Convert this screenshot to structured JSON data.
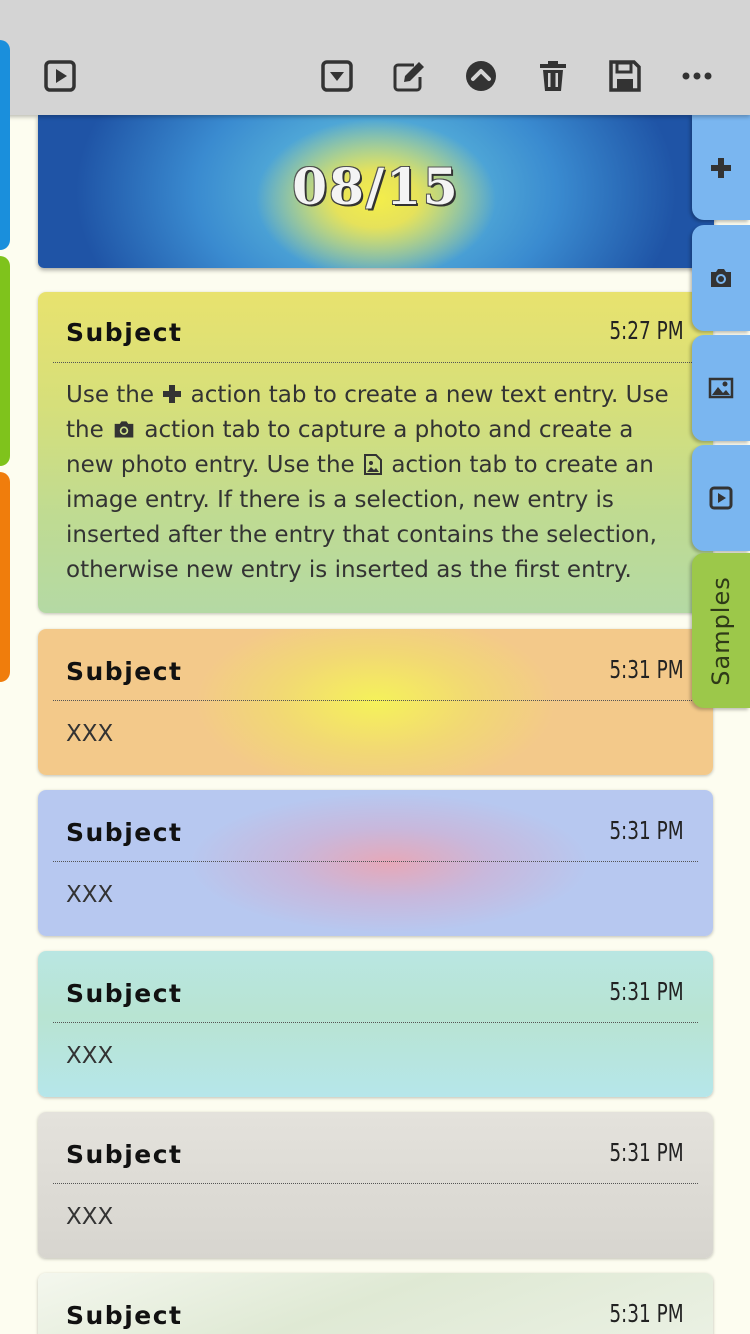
{
  "toolbar": {
    "buttons": [
      {
        "name": "play-icon"
      },
      {
        "name": "dropdown-icon"
      },
      {
        "name": "edit-icon"
      },
      {
        "name": "collapse-up-icon"
      },
      {
        "name": "trash-icon"
      },
      {
        "name": "save-icon"
      },
      {
        "name": "more-icon"
      }
    ]
  },
  "left_tabs": [
    {
      "color": "#1a8fdc"
    },
    {
      "color": "#7fc31c"
    },
    {
      "color": "#f07d0c"
    }
  ],
  "banner": {
    "date": "08/15"
  },
  "right_tabs": {
    "add": "plus-icon",
    "camera": "camera-icon",
    "image": "image-icon",
    "play": "play-icon",
    "samples": "Samples"
  },
  "entries": [
    {
      "subject": "Subject",
      "time": "5:27 PM",
      "body": {
        "t1": "Use the",
        "t2": "action tab to create a new text entry. Use the",
        "t3": "action tab to capture a photo and create a new photo entry. Use the",
        "t4": "action tab to create an image entry. If there is a selection, new entry is inserted after the entry that contains the selection, otherwise new entry is inserted as the first entry."
      }
    },
    {
      "subject": "Subject",
      "time": "5:31 PM",
      "body": "XXX"
    },
    {
      "subject": "Subject",
      "time": "5:31 PM",
      "body": "XXX"
    },
    {
      "subject": "Subject",
      "time": "5:31 PM",
      "body": "XXX"
    },
    {
      "subject": "Subject",
      "time": "5:31 PM",
      "body": "XXX"
    },
    {
      "subject": "Subject",
      "time": "5:31 PM"
    }
  ]
}
